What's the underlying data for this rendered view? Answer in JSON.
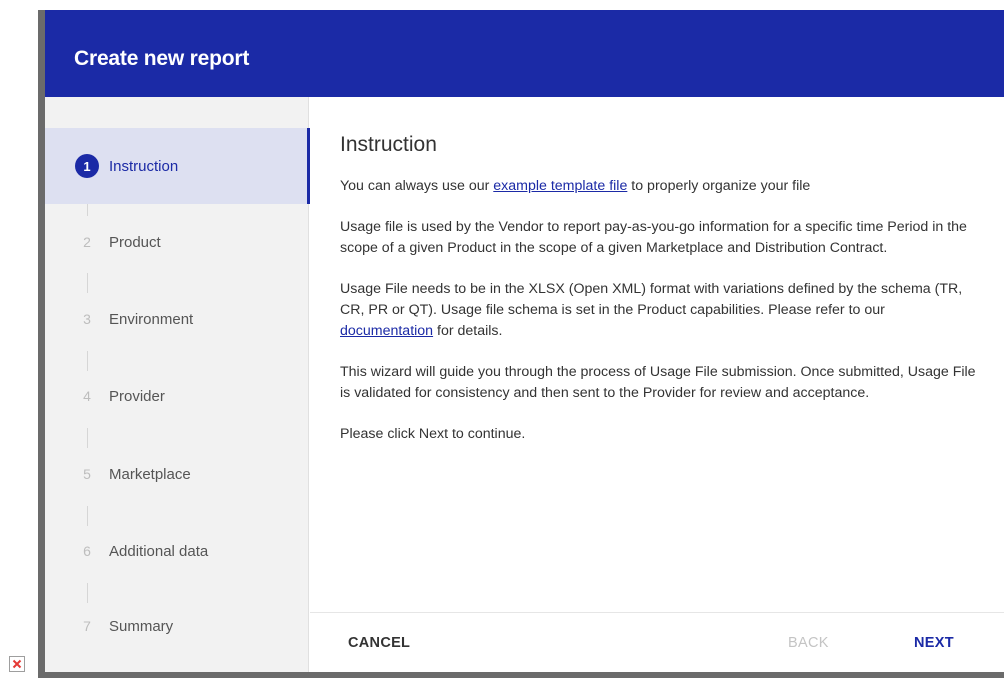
{
  "dialog": {
    "title": "Create new report"
  },
  "steps": [
    {
      "number": "1",
      "label": "Instruction",
      "active": true
    },
    {
      "number": "2",
      "label": "Product",
      "active": false
    },
    {
      "number": "3",
      "label": "Environment",
      "active": false
    },
    {
      "number": "4",
      "label": "Provider",
      "active": false
    },
    {
      "number": "5",
      "label": "Marketplace",
      "active": false
    },
    {
      "number": "6",
      "label": "Additional data",
      "active": false
    },
    {
      "number": "7",
      "label": "Summary",
      "active": false
    }
  ],
  "content": {
    "title": "Instruction",
    "p1_before": "You can always use our ",
    "p1_link": "example template file",
    "p1_after": " to properly organize your file",
    "p2": "Usage file is used by the Vendor to report pay-as-you-go information for a specific time Period in the scope of a given Product in the scope of a given Marketplace and Distribution Contract.",
    "p3_before": "Usage File needs to be in the XLSX (Open XML) format with variations defined by the schema (TR, CR, PR or QT). Usage file schema is set in the Product capabilities. Please refer to our ",
    "p3_link": "documentation",
    "p3_after": " for details.",
    "p4": "This wizard will guide you through the process of Usage File submission. Once submitted, Usage File is validated for consistency and then sent to the Provider for review and acceptance.",
    "p5": "Please click Next to continue."
  },
  "footer": {
    "cancel_label": "CANCEL",
    "back_label": "BACK",
    "next_label": "NEXT"
  },
  "colors": {
    "primary": "#1b2aa6",
    "active_step_bg": "#dde0f1",
    "disabled": "#c4c4c4"
  },
  "icons": {
    "broken_image": "broken-image-icon"
  }
}
